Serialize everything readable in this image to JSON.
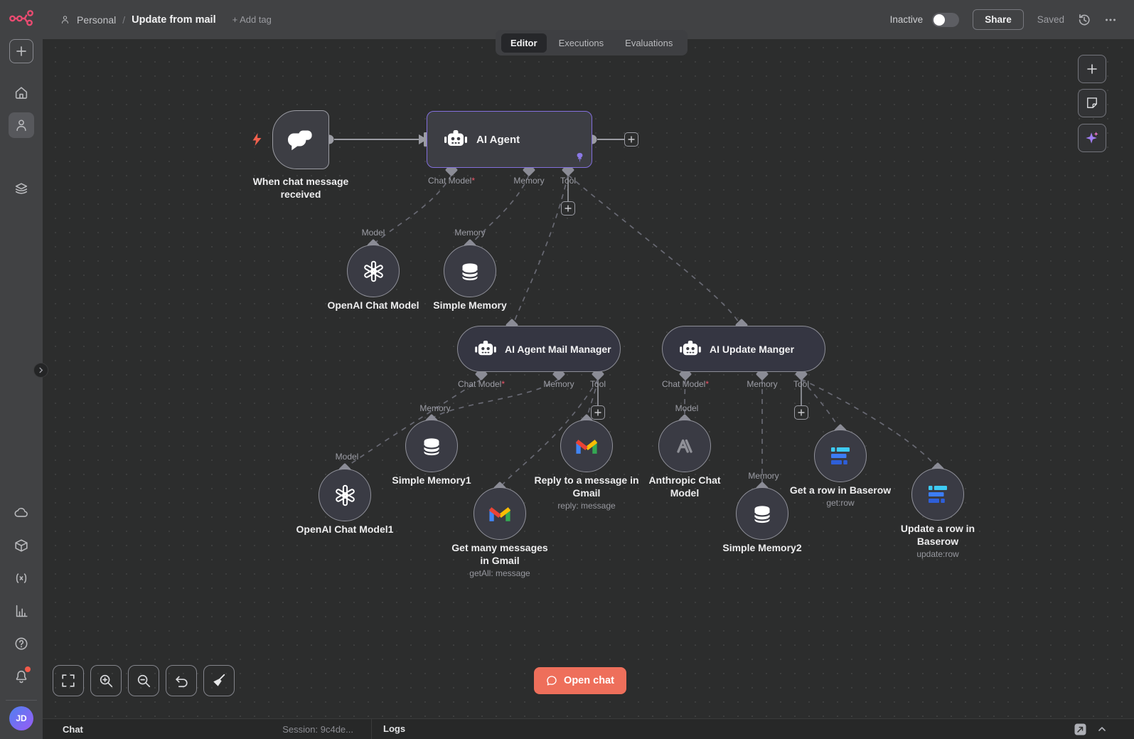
{
  "header": {
    "breadcrumb": {
      "project": "Personal",
      "separator": "/",
      "title": "Update from mail",
      "add_tag": "+ Add tag"
    },
    "status": {
      "label": "Inactive"
    },
    "share_label": "Share",
    "saved_label": "Saved"
  },
  "tabs": {
    "editor": "Editor",
    "executions": "Executions",
    "evaluations": "Evaluations"
  },
  "sidebar": {
    "avatar_initials": "JD"
  },
  "canvas": {
    "open_chat": "Open chat",
    "nodes": [
      {
        "name": "When chat message received"
      },
      {
        "name": "AI Agent"
      },
      {
        "name": "OpenAI Chat Model"
      },
      {
        "name": "Simple Memory"
      },
      {
        "name": "AI Agent Mail Manager"
      },
      {
        "name": "AI Update Manger"
      },
      {
        "name": "OpenAI Chat Model1"
      },
      {
        "name": "Simple Memory1"
      },
      {
        "name": "Get many messages in Gmail",
        "subtitle": "getAll: message"
      },
      {
        "name": "Reply to a message in Gmail",
        "subtitle": "reply: message"
      },
      {
        "name": "Anthropic Chat Model"
      },
      {
        "name": "Simple Memory2"
      },
      {
        "name": "Get a row in Baserow",
        "subtitle": "get:row"
      },
      {
        "name": "Update a row in Baserow",
        "subtitle": "update:row"
      }
    ],
    "labels": [
      {
        "text": "Chat Model",
        "star": "*"
      },
      {
        "text": "Memory",
        "star": ""
      },
      {
        "text": "Tool",
        "star": ""
      },
      {
        "text": "Model",
        "star": ""
      },
      {
        "text": "Memory",
        "star": ""
      },
      {
        "text": "Chat Model",
        "star": "*"
      },
      {
        "text": "Memory",
        "star": ""
      },
      {
        "text": "Tool",
        "star": ""
      },
      {
        "text": "Memory",
        "star": ""
      },
      {
        "text": "Model",
        "star": ""
      },
      {
        "text": "Chat Model",
        "star": "*"
      },
      {
        "text": "Memory",
        "star": ""
      },
      {
        "text": "Tool",
        "star": ""
      },
      {
        "text": "Model",
        "star": ""
      },
      {
        "text": "Memory",
        "star": ""
      }
    ]
  },
  "bottom_bar": {
    "chat": "Chat",
    "session": "Session: 9c4de...",
    "logs": "Logs"
  },
  "colors": {
    "accent_pink": "#ea4b71",
    "agent_border": "#8370dd",
    "open_chat": "#ee6f5b",
    "required_star": "#f0566b",
    "gmail": [
      "#EA4335",
      "#4285F4",
      "#34A853",
      "#FBBC04"
    ],
    "baserow": [
      "#3ECBF4",
      "#3D7DF5",
      "#2E5FD9"
    ]
  }
}
